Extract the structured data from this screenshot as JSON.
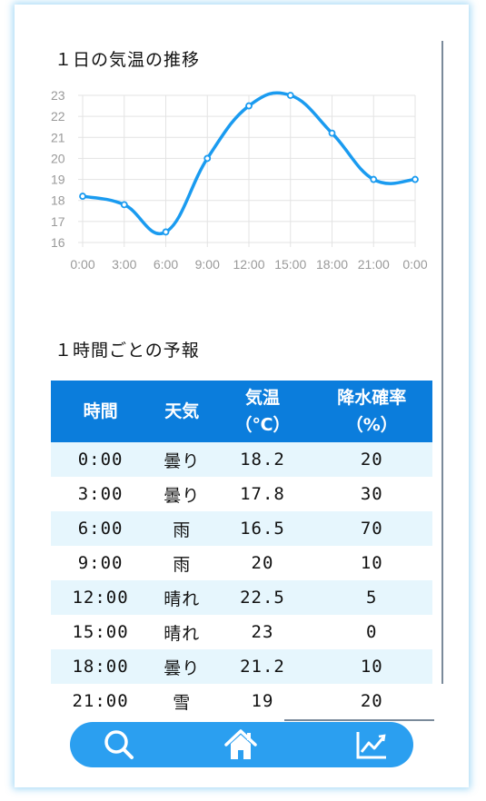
{
  "chart_section": {
    "title": "１日の気温の推移"
  },
  "forecast_section": {
    "title": "１時間ごとの予報"
  },
  "chart_data": {
    "type": "line",
    "title": "",
    "xlabel": "",
    "ylabel": "",
    "categories": [
      "0:00",
      "3:00",
      "6:00",
      "9:00",
      "12:00",
      "15:00",
      "18:00",
      "21:00",
      "0:00"
    ],
    "values": [
      18.2,
      17.8,
      16.5,
      20,
      22.5,
      23,
      21.2,
      19,
      19
    ],
    "ylim": [
      16,
      23
    ],
    "yticks": [
      16,
      17,
      18,
      19,
      20,
      21,
      22,
      23
    ],
    "grid": true,
    "smooth": true,
    "color": "#1a9bf0"
  },
  "table": {
    "headers": [
      {
        "line1": "時間",
        "line2": ""
      },
      {
        "line1": "天気",
        "line2": ""
      },
      {
        "line1": "気温",
        "line2": "（℃）"
      },
      {
        "line1": "降水確率",
        "line2": "（%）"
      }
    ],
    "rows": [
      {
        "time": "0:00",
        "weather": "曇り",
        "temp": "18.2",
        "rain": "20"
      },
      {
        "time": "3:00",
        "weather": "曇り",
        "temp": "17.8",
        "rain": "30"
      },
      {
        "time": "6:00",
        "weather": "雨",
        "temp": "16.5",
        "rain": "70"
      },
      {
        "time": "9:00",
        "weather": "雨",
        "temp": "20",
        "rain": "10"
      },
      {
        "time": "12:00",
        "weather": "晴れ",
        "temp": "22.5",
        "rain": "5"
      },
      {
        "time": "15:00",
        "weather": "晴れ",
        "temp": "23",
        "rain": "0"
      },
      {
        "time": "18:00",
        "weather": "曇り",
        "temp": "21.2",
        "rain": "10"
      },
      {
        "time": "21:00",
        "weather": "雪",
        "temp": "19",
        "rain": "20"
      }
    ]
  },
  "nav": {
    "items": [
      {
        "icon": "search-icon"
      },
      {
        "icon": "home-icon"
      },
      {
        "icon": "chart-icon"
      }
    ],
    "bar_color": "#2b9ff0"
  }
}
